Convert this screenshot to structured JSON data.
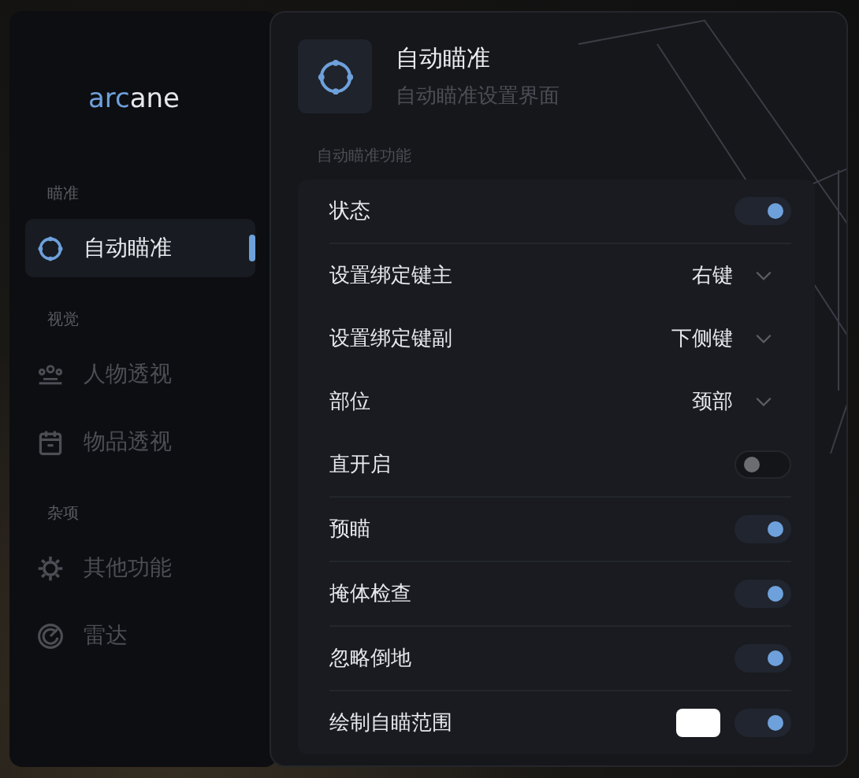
{
  "logo": {
    "accent": "arc",
    "rest": "ane"
  },
  "sidebar": {
    "sections": [
      {
        "title": "瞄准",
        "items": [
          {
            "label": "自动瞄准",
            "kind": "crosshair",
            "selected": true
          }
        ]
      },
      {
        "title": "视觉",
        "items": [
          {
            "label": "人物透视",
            "kind": "people",
            "selected": false
          },
          {
            "label": "物品透视",
            "kind": "box",
            "selected": false
          }
        ]
      },
      {
        "title": "杂项",
        "items": [
          {
            "label": "其他功能",
            "kind": "gear",
            "selected": false
          },
          {
            "label": "雷达",
            "kind": "radar",
            "selected": false
          }
        ]
      }
    ]
  },
  "header": {
    "title": "自动瞄准",
    "subtitle": "自动瞄准设置界面"
  },
  "section_title": "自动瞄准功能",
  "rows": [
    {
      "kind": "toggle",
      "label": "状态",
      "on": true
    },
    {
      "kind": "select",
      "label": "设置绑定键主",
      "value": "右键"
    },
    {
      "kind": "select",
      "label": "设置绑定键副",
      "value": "下侧键"
    },
    {
      "kind": "select",
      "label": "部位",
      "value": "颈部"
    },
    {
      "kind": "toggle",
      "label": "直开启",
      "on": false
    },
    {
      "kind": "toggle",
      "label": "预瞄",
      "on": true
    },
    {
      "kind": "toggle",
      "label": "掩体检查",
      "on": true
    },
    {
      "kind": "toggle",
      "label": "忽略倒地",
      "on": true
    },
    {
      "kind": "toggle_color",
      "label": "绘制自瞄范围",
      "on": true,
      "color": "#ffffff"
    }
  ]
}
